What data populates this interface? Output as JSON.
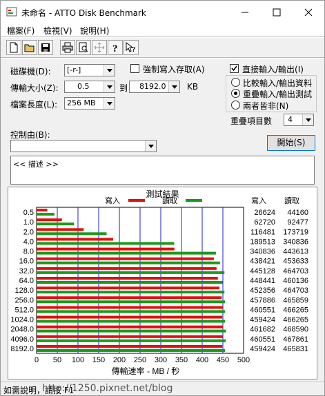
{
  "window": {
    "title": "未命名 - ATTO Disk Benchmark"
  },
  "menu": {
    "items": [
      "檔案(F)",
      "檢視(V)",
      "說明(H)"
    ]
  },
  "toolbar": {
    "icons": [
      "new-icon",
      "open-icon",
      "save-icon",
      "print-icon",
      "print-preview-icon",
      "move-icon",
      "help-icon",
      "context-help-icon"
    ]
  },
  "settings": {
    "drive_label": "磁碟機(D):",
    "drive_value": "[-r-]",
    "force_write_label": "強制寫入存取(A)",
    "direct_io_label": "直接輸入/輸出(I)",
    "transfer_label": "傳輸大小(Z):",
    "transfer_from": "0.5",
    "to_label": "到",
    "transfer_to": "8192.0",
    "unit_label": "KB",
    "length_label": "檔案長度(L):",
    "length_value": "256 MB",
    "radio_compare": "比較輸入/輸出資料",
    "radio_overlap": "重疊輸入/輸出測試",
    "radio_neither": "兩者皆非(N)",
    "queue_label": "重疊項目數",
    "queue_value": "4",
    "control_label": "控制由(B):",
    "start_button": "開始(S)",
    "description": "<< 描述 >>"
  },
  "colors": {
    "write": "#e01010",
    "read": "#1a9a1a",
    "grid": "#1e1ed2"
  },
  "chart_data": {
    "type": "bar",
    "title": "測試結果",
    "legend": [
      "寫入",
      "讀取"
    ],
    "xlabel": "傳輸速率 - MB / 秒",
    "xlim": [
      0,
      500
    ],
    "xticks": [
      "0",
      "50",
      "100",
      "150",
      "200",
      "250",
      "300",
      "350",
      "400",
      "450",
      "500"
    ],
    "categories": [
      "0.5",
      "1.0",
      "2.0",
      "4.0",
      "8.0",
      "16.0",
      "32.0",
      "64.0",
      "128.0",
      "256.0",
      "512.0",
      "1024.0",
      "2048.0",
      "4096.0",
      "8192.0"
    ],
    "series": [
      {
        "name": "寫入",
        "values": [
          26.0,
          61.25,
          113.75,
          185.1,
          332.85,
          428.15,
          434.7,
          437.9,
          441.7,
          447.1,
          449.75,
          448.65,
          450.85,
          449.75,
          448.65
        ]
      },
      {
        "name": "讀取",
        "values": [
          43.1,
          90.3,
          169.2,
          332.4,
          433.2,
          443.0,
          453.8,
          449.2,
          453.8,
          455.0,
          455.3,
          455.3,
          457.6,
          456.9,
          455.0
        ]
      }
    ],
    "table": {
      "headers": [
        "寫入",
        "讀取"
      ],
      "write": [
        "26624",
        "62720",
        "116481",
        "189513",
        "340836",
        "438421",
        "445128",
        "448441",
        "452356",
        "457886",
        "460551",
        "459424",
        "461682",
        "460551",
        "459424"
      ],
      "read": [
        "44160",
        "92477",
        "173719",
        "340836",
        "443613",
        "453633",
        "464703",
        "460136",
        "464703",
        "465859",
        "466265",
        "466265",
        "468590",
        "467861",
        "465831"
      ]
    }
  },
  "status": {
    "text": "如需說明，請按 F1",
    "watermark": "http://1250.pixnet.net/blog"
  }
}
